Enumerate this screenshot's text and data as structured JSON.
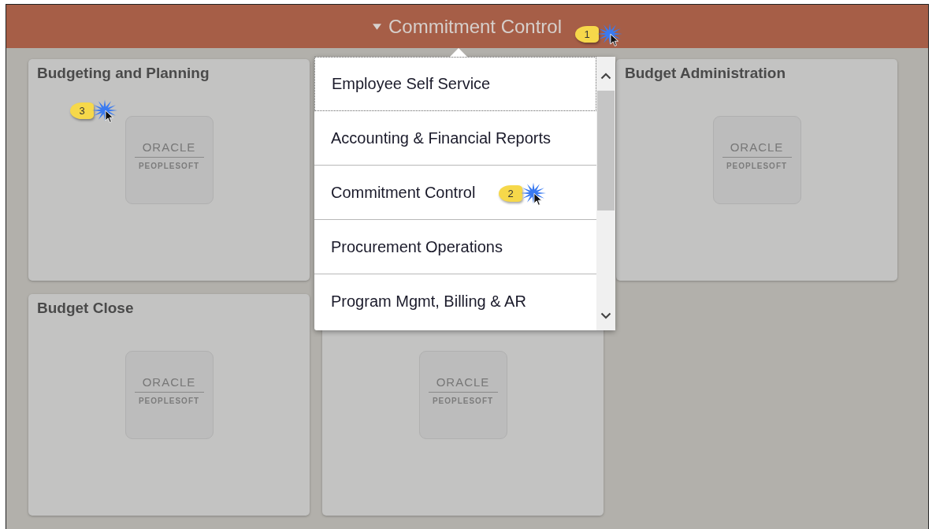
{
  "header": {
    "title": "Commitment Control"
  },
  "tiles": [
    {
      "kind": "tile",
      "title": "Budgeting and Planning",
      "logo": {
        "line_1": "ORACLE",
        "line_2": "PEOPLESOFT"
      }
    },
    {
      "kind": "tile",
      "title": "Budget Administration",
      "logo": {
        "line_1": "ORACLE",
        "line_2": "PEOPLESOFT"
      }
    },
    {
      "kind": "tile",
      "title": "Budget Close",
      "logo": {
        "line_1": "ORACLE",
        "line_2": "PEOPLESOFT"
      }
    },
    {
      "kind": "tile",
      "logo": {
        "line_1": "ORACLE",
        "line_2": "PEOPLESOFT"
      }
    }
  ],
  "menu": {
    "items": [
      {
        "label": "Employee Self Service",
        "focused": true
      },
      {
        "label": "Accounting & Financial Reports",
        "focused": false
      },
      {
        "label": "Commitment Control",
        "focused": false
      },
      {
        "label": "Procurement Operations",
        "focused": false
      },
      {
        "label": "Program Mgmt, Billing & AR",
        "focused": false
      }
    ]
  },
  "callouts": [
    {
      "number": "1"
    },
    {
      "number": "2"
    },
    {
      "number": "3"
    }
  ]
}
